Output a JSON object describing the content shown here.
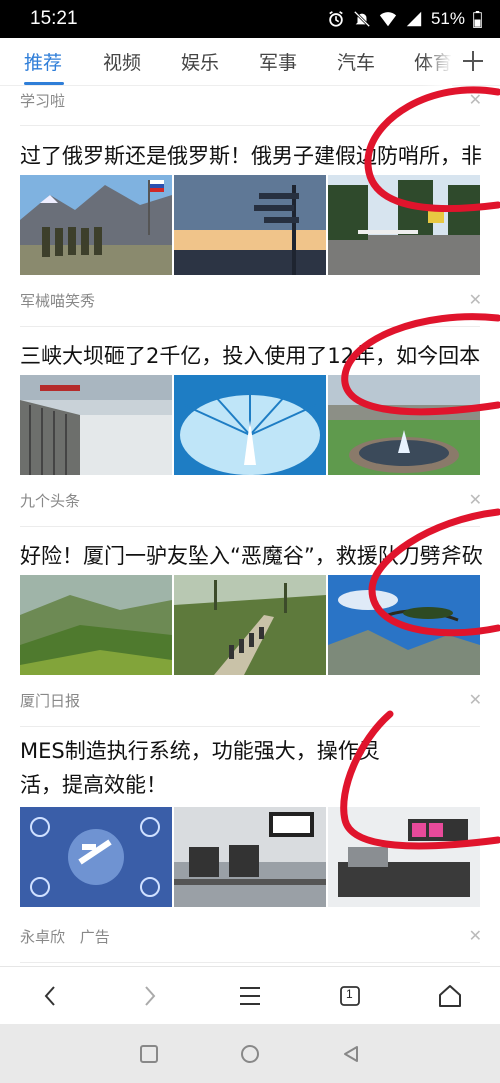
{
  "status": {
    "time": "15:21",
    "battery": "51%"
  },
  "tabs": [
    {
      "label": "推荐",
      "active": true
    },
    {
      "label": "视频"
    },
    {
      "label": "娱乐"
    },
    {
      "label": "军事"
    },
    {
      "label": "汽车"
    },
    {
      "label": "体育"
    }
  ],
  "feed": {
    "top_source": "学习啦",
    "articles": [
      {
        "title": "过了俄罗斯还是俄罗斯！俄男子建假边防哨所，非",
        "source": "军械喵笑秀",
        "thumbs": [
          "soldiers-mountain-image",
          "signpost-sunset-image",
          "checkpoint-road-image"
        ]
      },
      {
        "title": "三峡大坝砸了2千亿，投入使用了12年，如今回本",
        "source": "九个头条",
        "thumbs": [
          "dam-spillway-image",
          "fountain-sphere-image",
          "dam-park-image"
        ]
      },
      {
        "title": "好险！厦门一驴友坠入“恶魔谷”，救援队刀劈斧砍",
        "source": "厦门日报",
        "thumbs": [
          "green-hills-image",
          "hikers-trail-image",
          "cliff-pine-image"
        ]
      },
      {
        "title": "MES制造执行系统，功能强大，操作灵活，提高效能！",
        "source": "永卓欣",
        "ad_label": "广告",
        "thumbs": [
          "mes-icons-image",
          "factory-line-image",
          "factory-machine-image"
        ]
      }
    ]
  },
  "close_glyph": "✕",
  "colors": {
    "accent": "#2f7ed8",
    "annotation": "#e0142c"
  },
  "browser_nav": {
    "tab_count": "1"
  }
}
